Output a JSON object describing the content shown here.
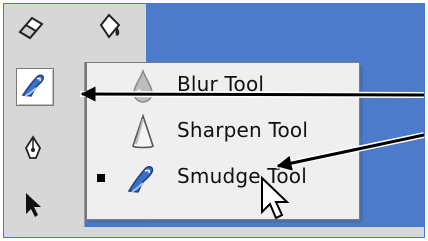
{
  "menu": {
    "items": [
      {
        "label": "Blur Tool",
        "icon": "blur-drop-icon",
        "checked": false
      },
      {
        "label": "Sharpen Tool",
        "icon": "sharpen-cone-icon",
        "checked": false
      },
      {
        "label": "Smudge Tool",
        "icon": "smudge-finger-icon",
        "checked": true
      }
    ]
  },
  "toolbar": {
    "tools": [
      "eraser-icon",
      "paint-bucket-icon",
      "smudge-finger-icon",
      "pen-icon",
      "path-select-arrow-icon"
    ]
  },
  "colors": {
    "background": "#4c7bcb",
    "toolbar": "#d7d7d7",
    "menu": "#efefef"
  }
}
